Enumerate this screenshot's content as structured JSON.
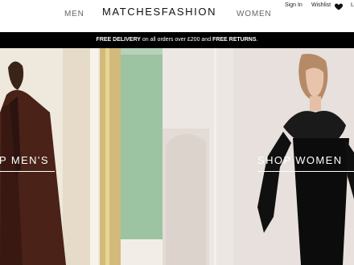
{
  "header": {
    "nav_men": "MEN",
    "logo": "MATCHESFASHION",
    "nav_women": "WOMEN",
    "sign_in": "Sign In",
    "wishlist": "Wishlist",
    "extra": "L"
  },
  "promo": {
    "part1": "FREE DELIVERY",
    "part2": " on all orders over £200 and ",
    "part3": "FREE RETURNS",
    "part4": "."
  },
  "hero": {
    "men_cta": "P MEN'S",
    "women_cta": "SHOP WOMEN"
  },
  "colors": {
    "promo_bg": "#000000",
    "panel_men_bg": "#e9e2d6",
    "panel_women_bg": "#ece6e2",
    "accent_green": "#9cc3a2"
  },
  "icons": [
    "heart-icon"
  ]
}
